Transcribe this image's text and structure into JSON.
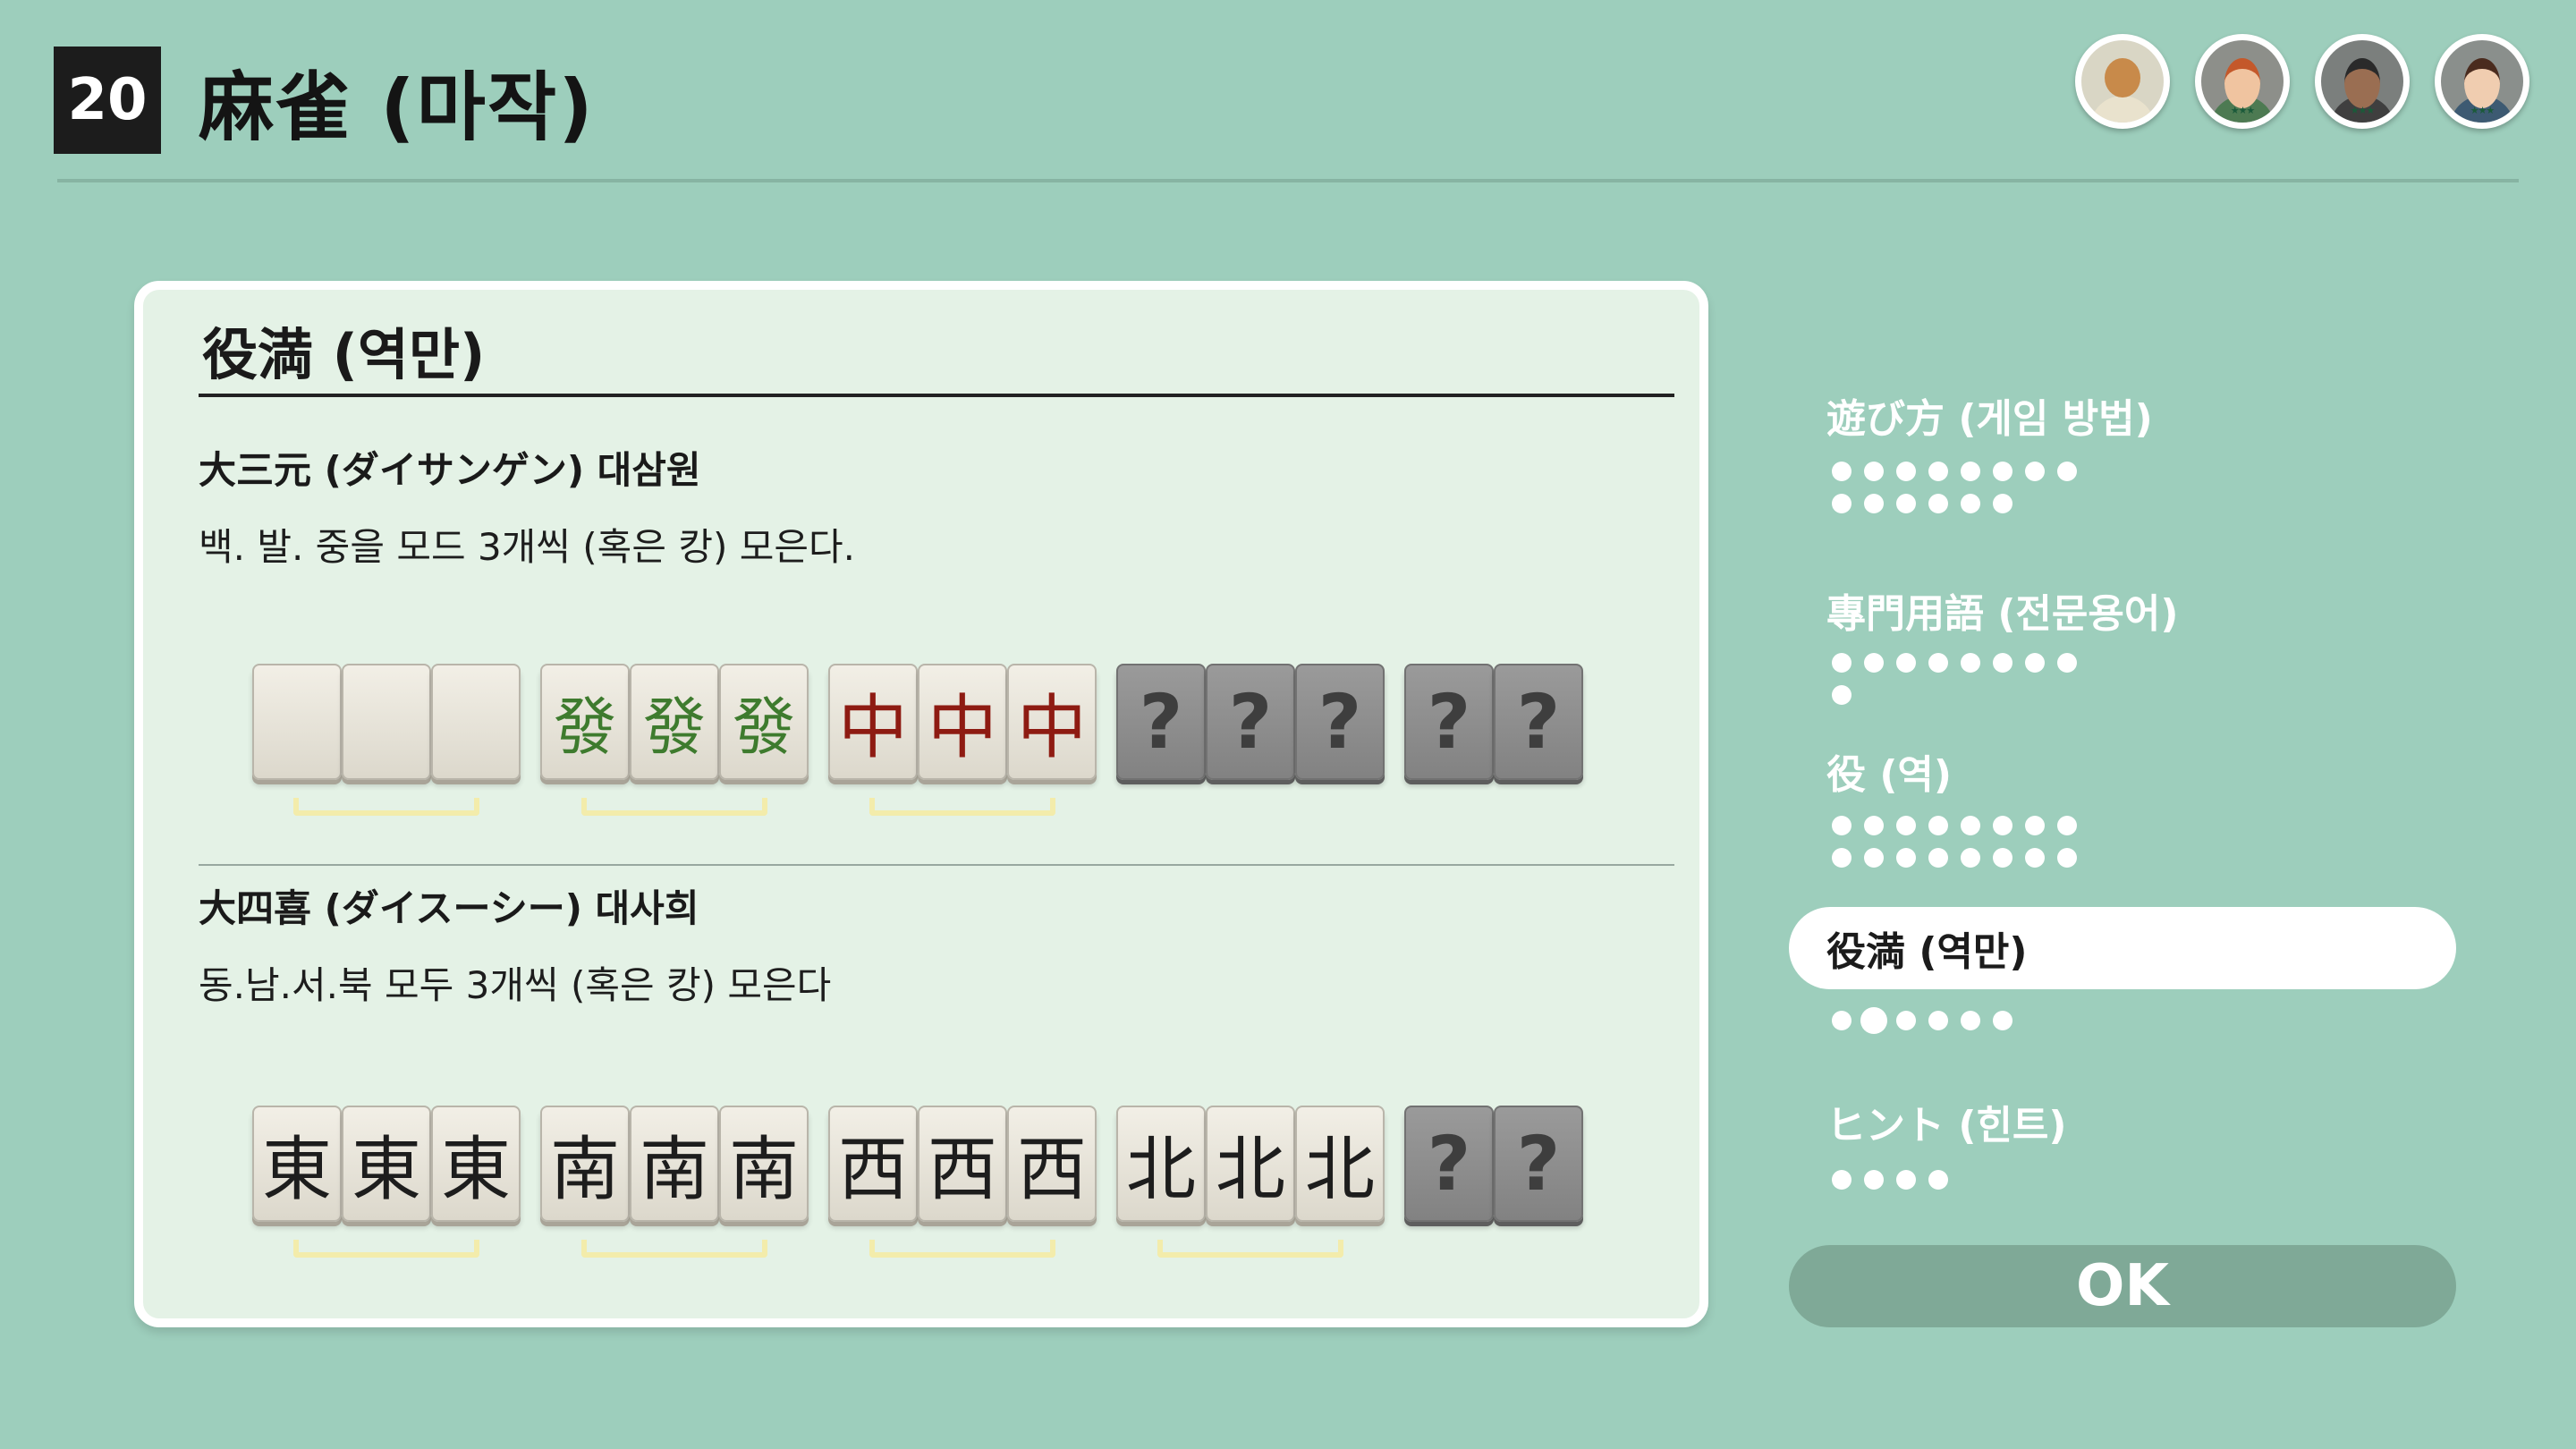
{
  "header": {
    "game_number": "20",
    "title": "麻雀 (마작)",
    "avatars": [
      {
        "name": "raccoon-npc",
        "skin": "#c88a4a",
        "body": "#e9e2cd",
        "bg": "#d9d6c5"
      },
      {
        "name": "player-red-hair",
        "skin": "#f0c4a0",
        "body": "#4d7a52",
        "bg": "#8d8f8a",
        "hair": "#c4582a",
        "stars": "★★★"
      },
      {
        "name": "player-dark",
        "skin": "#9a6e52",
        "body": "#3f3f3f",
        "bg": "#7b7f7d",
        "hair": "#2a2a2a",
        "stars": "★★★"
      },
      {
        "name": "player-glasses",
        "skin": "#f0cdb0",
        "body": "#3d5a72",
        "bg": "#8a8f8c",
        "hair": "#4a2b1e",
        "stars": "★★★"
      }
    ]
  },
  "panel": {
    "title": "役満 (역만)",
    "sections": [
      {
        "name": "大三元 (ダイサンゲン) 대삼원",
        "desc": "백. 발. 중을 모드 3개씩 (혹은 캉) 모은다.",
        "groups": [
          {
            "tiles": [
              "",
              "",
              ""
            ],
            "style": "white",
            "bracket": true
          },
          {
            "tiles": [
              "發",
              "發",
              "發"
            ],
            "style": "green",
            "bracket": true
          },
          {
            "tiles": [
              "中",
              "中",
              "中"
            ],
            "style": "red",
            "bracket": true
          },
          {
            "tiles": [
              "?",
              "?",
              "?"
            ],
            "style": "unknown",
            "bracket": false
          },
          {
            "tiles": [
              "?",
              "?"
            ],
            "style": "unknown",
            "bracket": false
          }
        ]
      },
      {
        "name": "大四喜 (ダイスーシー) 대사희",
        "desc": "동.남.서.북 모두 3개씩 (혹은 캉) 모은다",
        "groups": [
          {
            "tiles": [
              "東",
              "東",
              "東"
            ],
            "style": "black",
            "bracket": true
          },
          {
            "tiles": [
              "南",
              "南",
              "南"
            ],
            "style": "black",
            "bracket": true
          },
          {
            "tiles": [
              "西",
              "西",
              "西"
            ],
            "style": "black",
            "bracket": true
          },
          {
            "tiles": [
              "北",
              "北",
              "北"
            ],
            "style": "black",
            "bracket": true
          },
          {
            "tiles": [
              "?",
              "?"
            ],
            "style": "unknown",
            "bracket": false
          }
        ]
      }
    ]
  },
  "menu": {
    "items": [
      {
        "label": "遊び方 (게임 방법)",
        "dots": 14,
        "current": -1,
        "selected": false
      },
      {
        "label": "專門用語 (전문용어)",
        "dots": 9,
        "current": -1,
        "selected": false
      },
      {
        "label": "役 (역)",
        "dots": 16,
        "current": -1,
        "selected": false
      },
      {
        "label": "役満 (역만)",
        "dots": 6,
        "current": 1,
        "selected": true
      },
      {
        "label": "ヒント (힌트)",
        "dots": 4,
        "current": -1,
        "selected": false
      }
    ],
    "ok_label": "OK"
  },
  "colors": {
    "background": "#9dcebc",
    "panel": "#e4f2e6",
    "bracket": "#f3ecab",
    "ok_button": "#7fa997"
  }
}
